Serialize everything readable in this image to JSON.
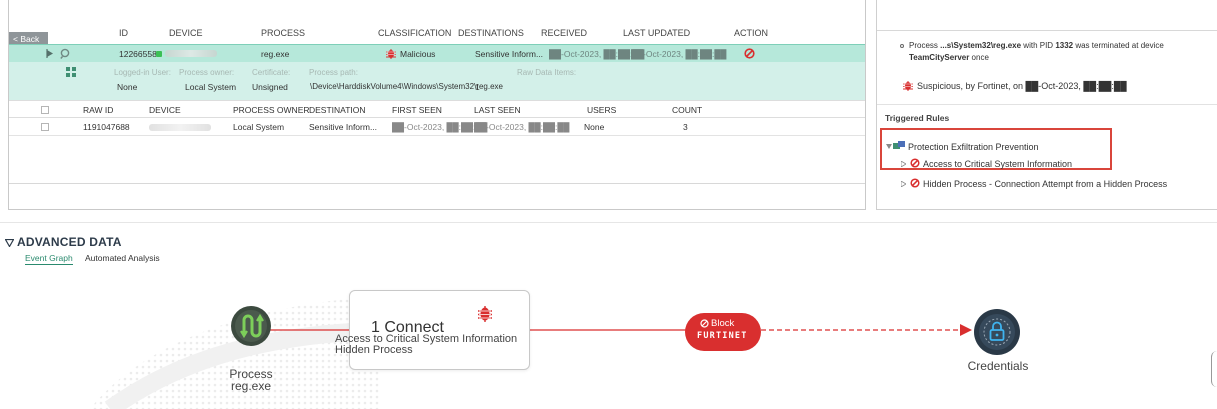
{
  "events_panel": {
    "back_label": "< Back",
    "columns": {
      "id": "ID",
      "device": "DEVICE",
      "process": "PROCESS",
      "classification": "CLASSIFICATION",
      "destinations": "DESTINATIONS",
      "received": "RECEIVED",
      "last_updated": "LAST UPDATED",
      "action": "ACTION"
    },
    "event": {
      "id": "12266558",
      "process": "reg.exe",
      "classification": "Malicious",
      "destinations": "Sensitive Inform...",
      "received": "██-Oct-2023, ██:██:██",
      "last_updated": "██-Oct-2023, ██:██:██"
    },
    "details": {
      "logged_in_user_label": "Logged-in User:",
      "logged_in_user_value": "None",
      "process_owner_label": "Process owner:",
      "process_owner_value": "Local System",
      "certificate_label": "Certificate:",
      "certificate_value": "Unsigned",
      "process_path_label": "Process path:",
      "process_path_value": "\\Device\\HarddiskVolume4\\Windows\\System32\\reg.exe",
      "raw_data_items_label": "Raw Data Items:",
      "raw_data_items_value": "1"
    },
    "raw_columns": {
      "raw_id": "RAW ID",
      "device": "DEVICE",
      "process_owner": "PROCESS OWNER",
      "destination": "DESTINATION",
      "first_seen": "FIRST SEEN",
      "last_seen": "LAST SEEN",
      "users": "USERS",
      "count": "COUNT"
    },
    "raw_row": {
      "raw_id": "1191047688",
      "process_owner": "Local System",
      "destination": "Sensitive Inform...",
      "first_seen": "██-Oct-2023, ██:██:██",
      "last_seen": "██-Oct-2023, ██:██:██",
      "users": "None",
      "count": "3"
    }
  },
  "side_panel": {
    "termination_line1_prefix": "Process ",
    "termination_line1_path": "...s\\System32\\reg.exe",
    "termination_line1_mid": " with PID ",
    "termination_line1_pid": "1332",
    "termination_line1_suffix": " was terminated at device",
    "termination_line2_device": "TeamCityServer",
    "termination_line2_suffix": " once",
    "suspicious_text": "Suspicious, by Fortinet, on ██-Oct-2023, ██:██:██",
    "triggered_rules_title": "Triggered Rules",
    "rule_group": "Protection Exfiltration Prevention",
    "rule_1": "Access to Critical System Information",
    "rule_2": "Hidden Process - Connection Attempt from a Hidden Process"
  },
  "advanced": {
    "title": "ADVANCED DATA",
    "tab_event_graph": "Event Graph",
    "tab_automated": "Automated Analysis",
    "process_node": {
      "label": "Process",
      "name": "reg.exe"
    },
    "connect_box": {
      "count_label": "1 Connect",
      "line_1": "Access to Critical System Information",
      "line_2": "Hidden Process"
    },
    "block": {
      "label": "Block",
      "brand": "FURTINET"
    },
    "credentials_node": {
      "label": "Credentials"
    }
  },
  "colors": {
    "event_row_bg": "#b6e8da",
    "malicious_red": "#d92f2f",
    "accent_green": "#2a8a6e",
    "highlight_box": "#d9453b",
    "credentials_node": "#2a3947"
  },
  "icons": [
    "expand-arrow-icon",
    "pin-icon",
    "device-status-icon",
    "malicious-bug-icon",
    "block-action-icon",
    "tree-icon",
    "checkbox-icon",
    "rule-group-icon",
    "chevron-right-icon",
    "blocked-rule-icon",
    "collapse-triangle-icon",
    "process-icon",
    "fortinet-bug-icon",
    "block-icon",
    "lock-icon"
  ]
}
